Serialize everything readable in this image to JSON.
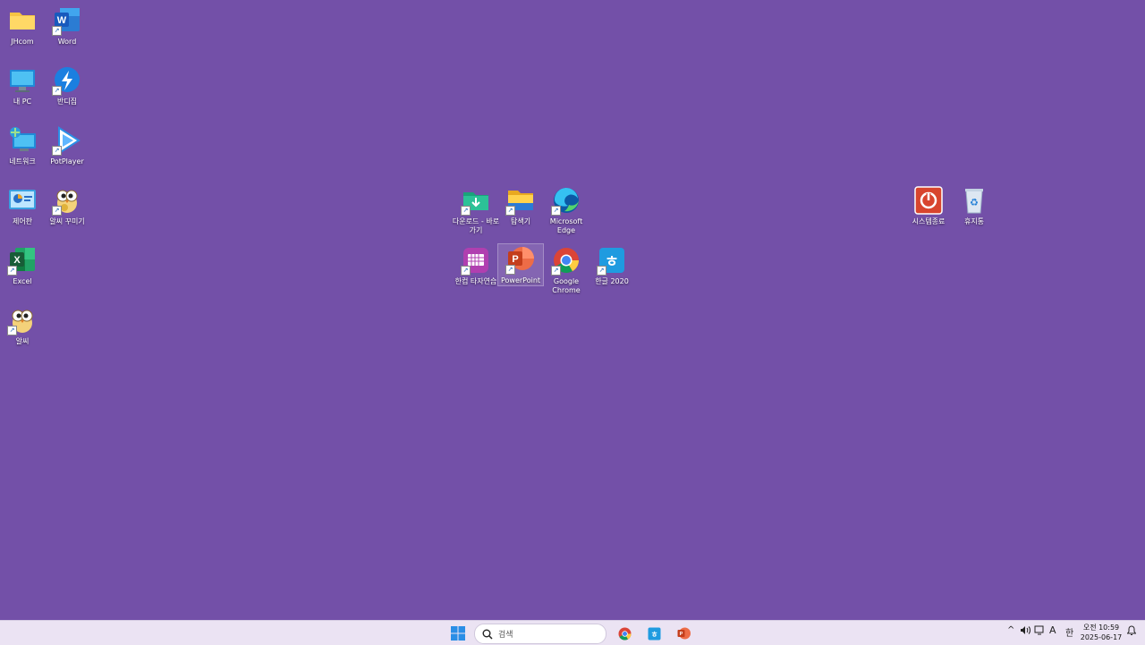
{
  "desktop": {
    "icons": [
      {
        "label": "JHcom",
        "icon": "folder-icon"
      },
      {
        "label": "Word",
        "icon": "word-icon"
      },
      {
        "label": "내 PC",
        "icon": "computer-icon"
      },
      {
        "label": "반디집",
        "icon": "bandizip-icon"
      },
      {
        "label": "네트워크",
        "icon": "network-icon"
      },
      {
        "label": "PotPlayer",
        "icon": "potplayer-icon"
      },
      {
        "label": "제어판",
        "icon": "control-panel-icon"
      },
      {
        "label": "알씨 꾸미기",
        "icon": "alsee-owl-icon"
      },
      {
        "label": "Excel",
        "icon": "excel-icon"
      },
      {
        "label": "알씨",
        "icon": "alsee-owl-icon"
      },
      {
        "label": "다운로드 - 바로 가기",
        "icon": "download-folder-icon"
      },
      {
        "label": "탐색기",
        "icon": "explorer-icon"
      },
      {
        "label": "Microsoft Edge",
        "icon": "edge-icon"
      },
      {
        "label": "한컴 타자연습",
        "icon": "typing-icon"
      },
      {
        "label": "PowerPoint",
        "icon": "powerpoint-icon"
      },
      {
        "label": "Google Chrome",
        "icon": "chrome-icon"
      },
      {
        "label": "한글 2020",
        "icon": "hangul-icon"
      },
      {
        "label": "시스템종료",
        "icon": "power-icon"
      },
      {
        "label": "휴지통",
        "icon": "recycle-bin-icon"
      }
    ]
  },
  "taskbar": {
    "search_placeholder": "검색",
    "pinned": [
      "start-icon",
      "chrome-icon",
      "hangul-icon",
      "powerpoint-icon"
    ],
    "tray": {
      "chevron": "^",
      "ime": "A",
      "lang": "한"
    },
    "clock": {
      "time": "오전 10:59",
      "date": "2025-06-17"
    }
  },
  "colors": {
    "desktop_bg": "#7350a8",
    "taskbar_bg": "#ebe3f3"
  }
}
